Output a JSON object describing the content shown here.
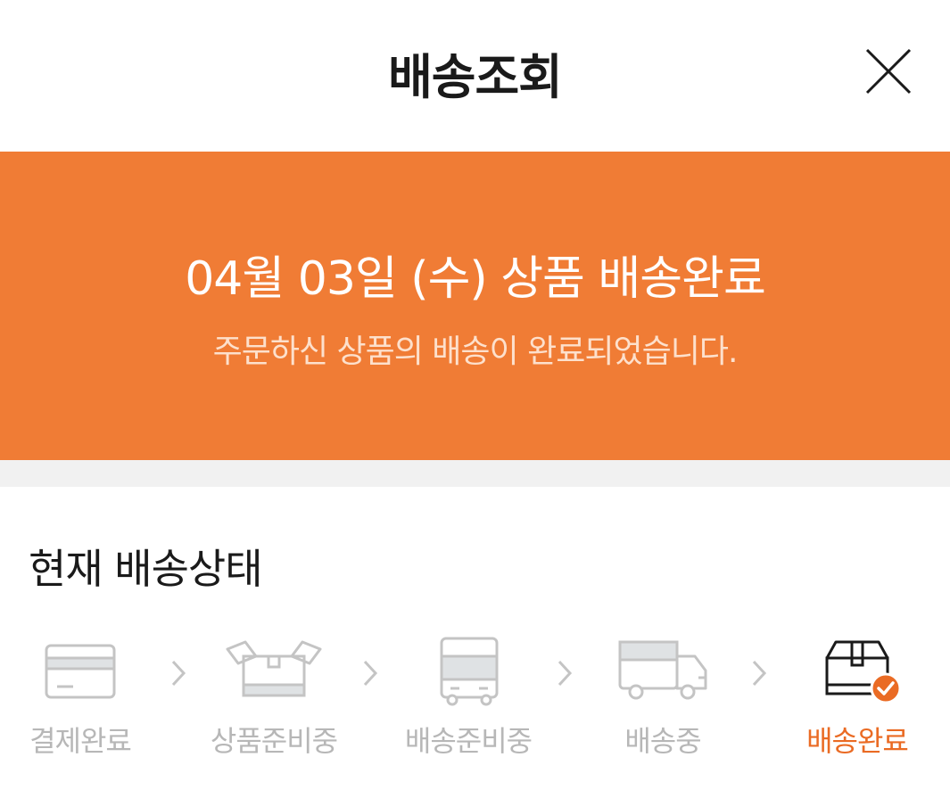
{
  "header": {
    "title": "배송조회",
    "close_icon": "close-icon"
  },
  "banner": {
    "title": "04월 03일 (수) 상품 배송완료",
    "subtitle": "주문하신 상품의 배송이 완료되었습니다.",
    "background_color": "#f07c35"
  },
  "status": {
    "title": "현재 배송상태",
    "active_color": "#ea6b24",
    "inactive_color": "#b7b7b7",
    "steps": [
      {
        "label": "결제완료",
        "icon": "credit-card-icon",
        "active": false
      },
      {
        "label": "상품준비중",
        "icon": "open-box-icon",
        "active": false
      },
      {
        "label": "배송준비중",
        "icon": "bus-icon",
        "active": false
      },
      {
        "label": "배송중",
        "icon": "delivery-truck-icon",
        "active": false
      },
      {
        "label": "배송완료",
        "icon": "delivered-box-check-icon",
        "active": true
      }
    ]
  }
}
